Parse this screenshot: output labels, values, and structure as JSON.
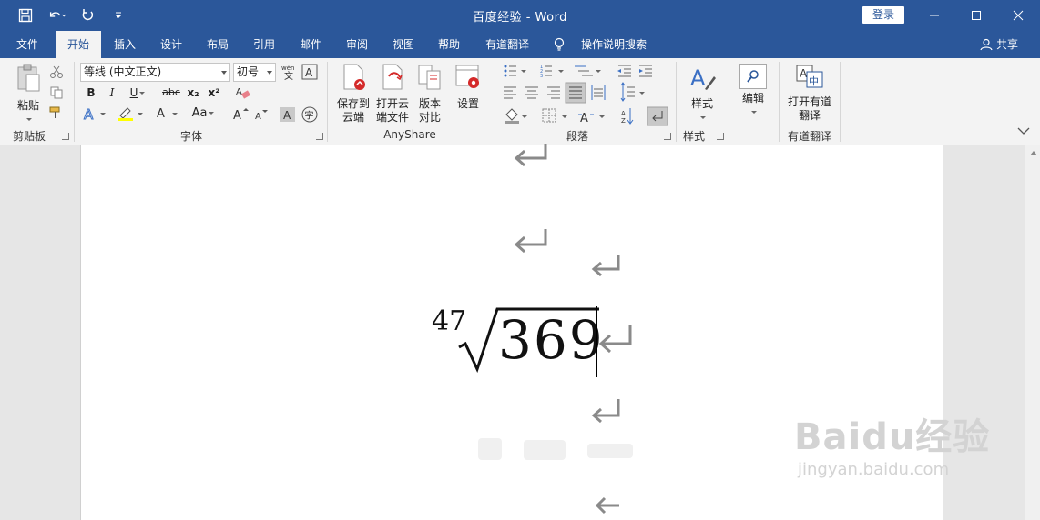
{
  "window": {
    "title": "百度经验  -  Word",
    "login_label": "登录"
  },
  "tabs": [
    {
      "label": "文件"
    },
    {
      "label": "开始",
      "active": true
    },
    {
      "label": "插入"
    },
    {
      "label": "设计"
    },
    {
      "label": "布局"
    },
    {
      "label": "引用"
    },
    {
      "label": "邮件"
    },
    {
      "label": "审阅"
    },
    {
      "label": "视图"
    },
    {
      "label": "帮助"
    },
    {
      "label": "有道翻译"
    }
  ],
  "tell_me": "操作说明搜索",
  "share_label": "共享",
  "ribbon": {
    "clipboard": {
      "paste": "粘贴",
      "label": "剪贴板"
    },
    "font": {
      "name_value": "等线 (中文正文)",
      "size_value": "初号",
      "label": "字体",
      "bold": "B",
      "italic": "I",
      "underline": "U",
      "strike": "abc",
      "subscript": "x₂",
      "superscript": "x²",
      "grow": "A",
      "shrink": "A",
      "case": "Aa"
    },
    "anyshare": {
      "save_cloud": "保存到云端",
      "open_cloud": "打开云端文件",
      "compare": "版本对比",
      "settings": "设置",
      "label": "AnyShare"
    },
    "paragraph": {
      "label": "段落"
    },
    "styles": {
      "button": "样式",
      "label": "样式"
    },
    "editing": {
      "button": "编辑"
    },
    "youdao": {
      "button": "打开有道翻译",
      "label": "有道翻译"
    }
  },
  "document": {
    "formula_index": "47",
    "formula_radicand": "369"
  },
  "watermark": {
    "main": "Baidu经验",
    "sub": "jingyan.baidu.com"
  }
}
